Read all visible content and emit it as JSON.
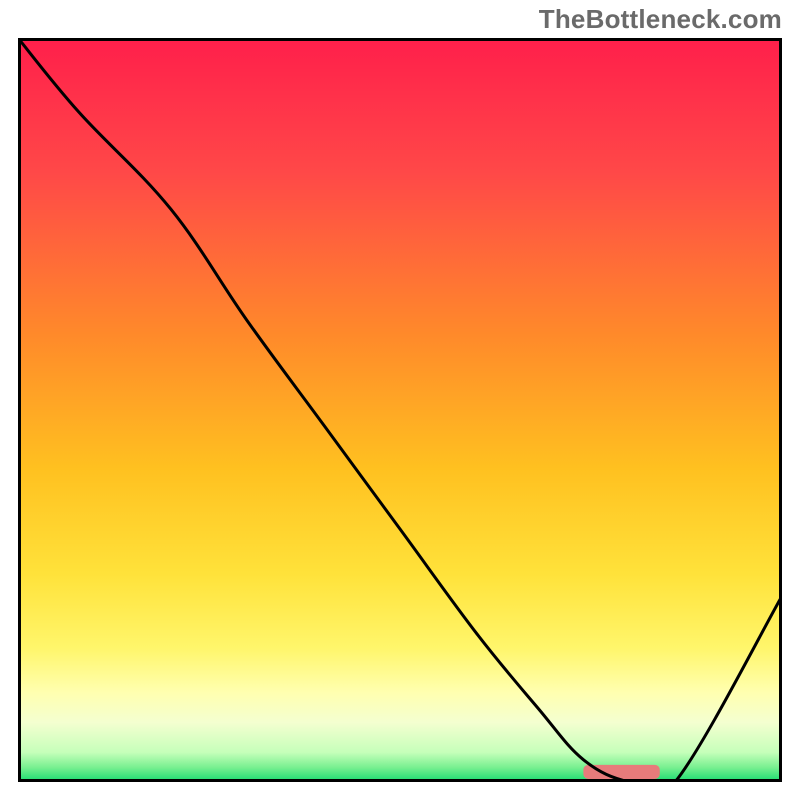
{
  "watermark": "TheBottleneck.com",
  "chart_data": {
    "type": "line",
    "title": "",
    "xlabel": "",
    "ylabel": "",
    "xlim": [
      0,
      100
    ],
    "ylim": [
      0,
      100
    ],
    "grid": false,
    "legend": false,
    "x": [
      0,
      8,
      20,
      30,
      40,
      50,
      60,
      68,
      74,
      80,
      86,
      100
    ],
    "values": [
      100,
      90,
      77,
      62,
      48,
      34,
      20,
      10,
      3,
      0,
      0,
      25
    ],
    "annotations": {
      "notch_bar": {
        "x_start": 74,
        "x_end": 84,
        "y": 0.5,
        "color": "#e77b7b",
        "height_pct": 1.1
      }
    },
    "background_gradient_stops": [
      {
        "pct": 0,
        "color": "#ff1f4b"
      },
      {
        "pct": 18,
        "color": "#ff4848"
      },
      {
        "pct": 40,
        "color": "#ff8a2a"
      },
      {
        "pct": 58,
        "color": "#ffc120"
      },
      {
        "pct": 72,
        "color": "#ffe23a"
      },
      {
        "pct": 82,
        "color": "#fff66b"
      },
      {
        "pct": 88,
        "color": "#ffffb0"
      },
      {
        "pct": 92,
        "color": "#f4ffd0"
      },
      {
        "pct": 96,
        "color": "#c6ffba"
      },
      {
        "pct": 98,
        "color": "#7af091"
      },
      {
        "pct": 100,
        "color": "#17db6f"
      }
    ],
    "border_color": "#000000",
    "line_color": "#000000"
  }
}
